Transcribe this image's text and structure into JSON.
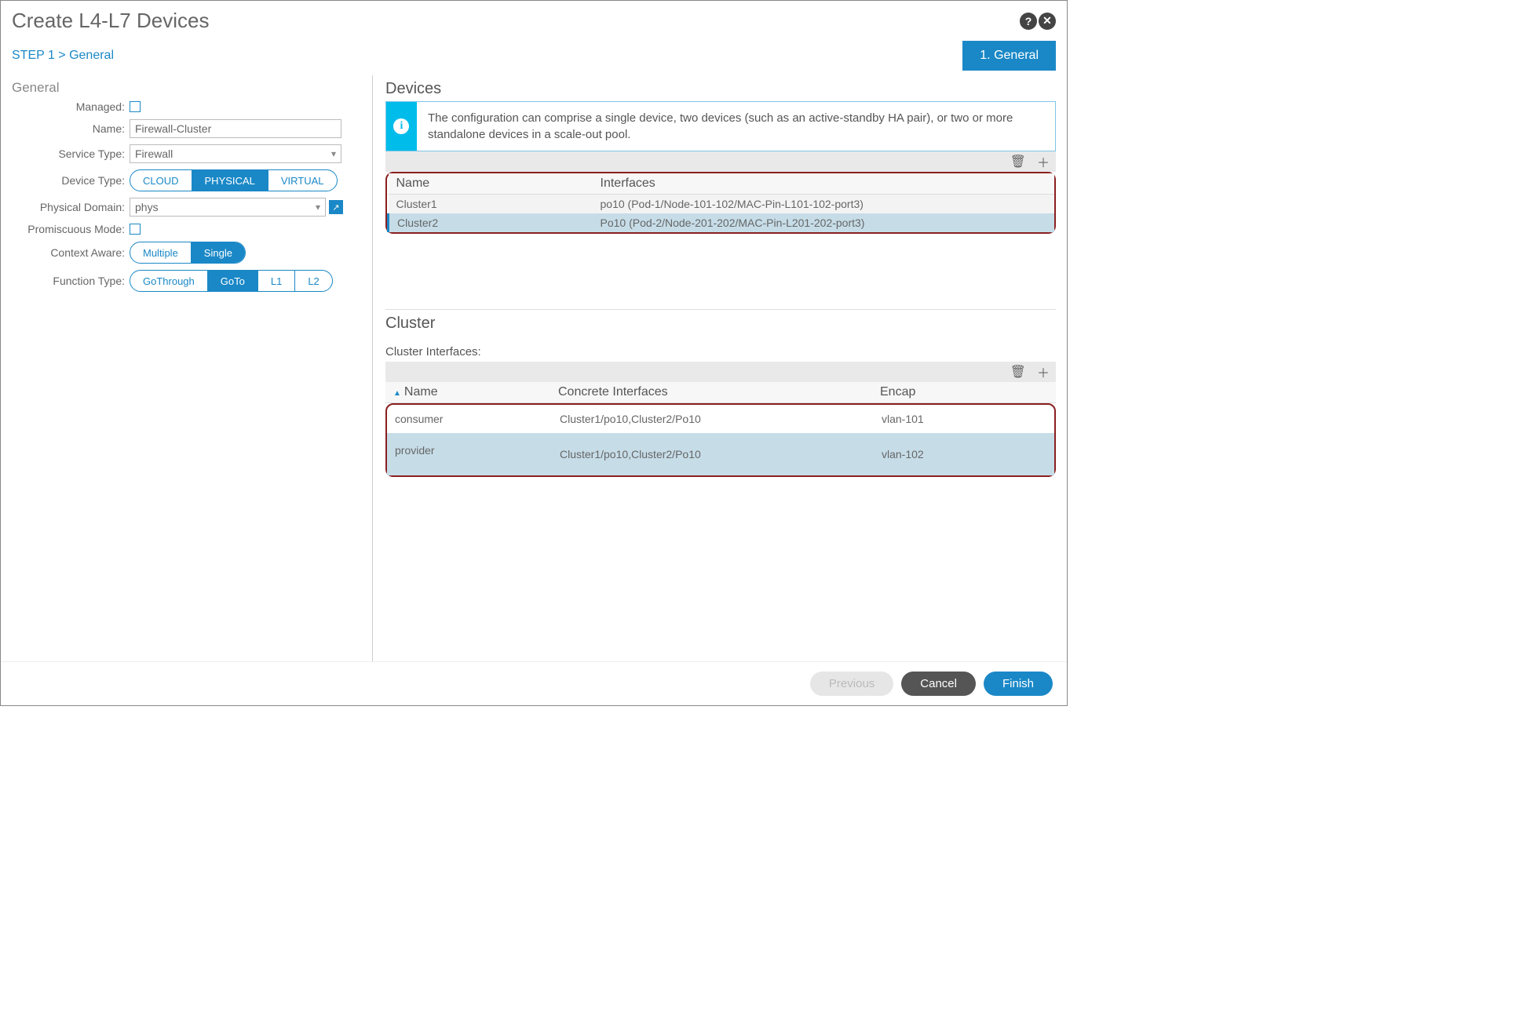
{
  "header": {
    "title": "Create L4-L7 Devices"
  },
  "step": {
    "crumb": "STEP 1 > General",
    "tab": "1. General"
  },
  "general": {
    "label": "General",
    "managed_label": "Managed:",
    "name_label": "Name:",
    "name_value": "Firewall-Cluster",
    "service_type_label": "Service Type:",
    "service_type_value": "Firewall",
    "device_type_label": "Device Type:",
    "device_type_options": [
      "CLOUD",
      "PHYSICAL",
      "VIRTUAL"
    ],
    "physical_domain_label": "Physical Domain:",
    "physical_domain_value": "phys",
    "promiscuous_label": "Promiscuous Mode:",
    "context_aware_label": "Context Aware:",
    "context_aware_options": [
      "Multiple",
      "Single"
    ],
    "function_type_label": "Function Type:",
    "function_type_options": [
      "GoThrough",
      "GoTo",
      "L1",
      "L2"
    ]
  },
  "devices": {
    "title": "Devices",
    "info": "The configuration can comprise a single device, two devices (such as an active-standby HA pair), or two or more standalone devices in a scale-out pool.",
    "columns": {
      "name": "Name",
      "interfaces": "Interfaces"
    },
    "rows": [
      {
        "name": "Cluster1",
        "interfaces": "po10 (Pod-1/Node-101-102/MAC-Pin-L101-102-port3)"
      },
      {
        "name": "Cluster2",
        "interfaces": "Po10 (Pod-2/Node-201-202/MAC-Pin-L201-202-port3)"
      }
    ]
  },
  "cluster": {
    "title": "Cluster",
    "subtitle": "Cluster Interfaces:",
    "columns": {
      "name": "Name",
      "concrete": "Concrete Interfaces",
      "encap": "Encap"
    },
    "rows": [
      {
        "name": "consumer",
        "concrete": "Cluster1/po10,Cluster2/Po10",
        "encap": "vlan-101"
      },
      {
        "name": "provider",
        "concrete": "Cluster1/po10,Cluster2/Po10",
        "encap": "vlan-102"
      }
    ]
  },
  "footer": {
    "previous": "Previous",
    "cancel": "Cancel",
    "finish": "Finish"
  }
}
